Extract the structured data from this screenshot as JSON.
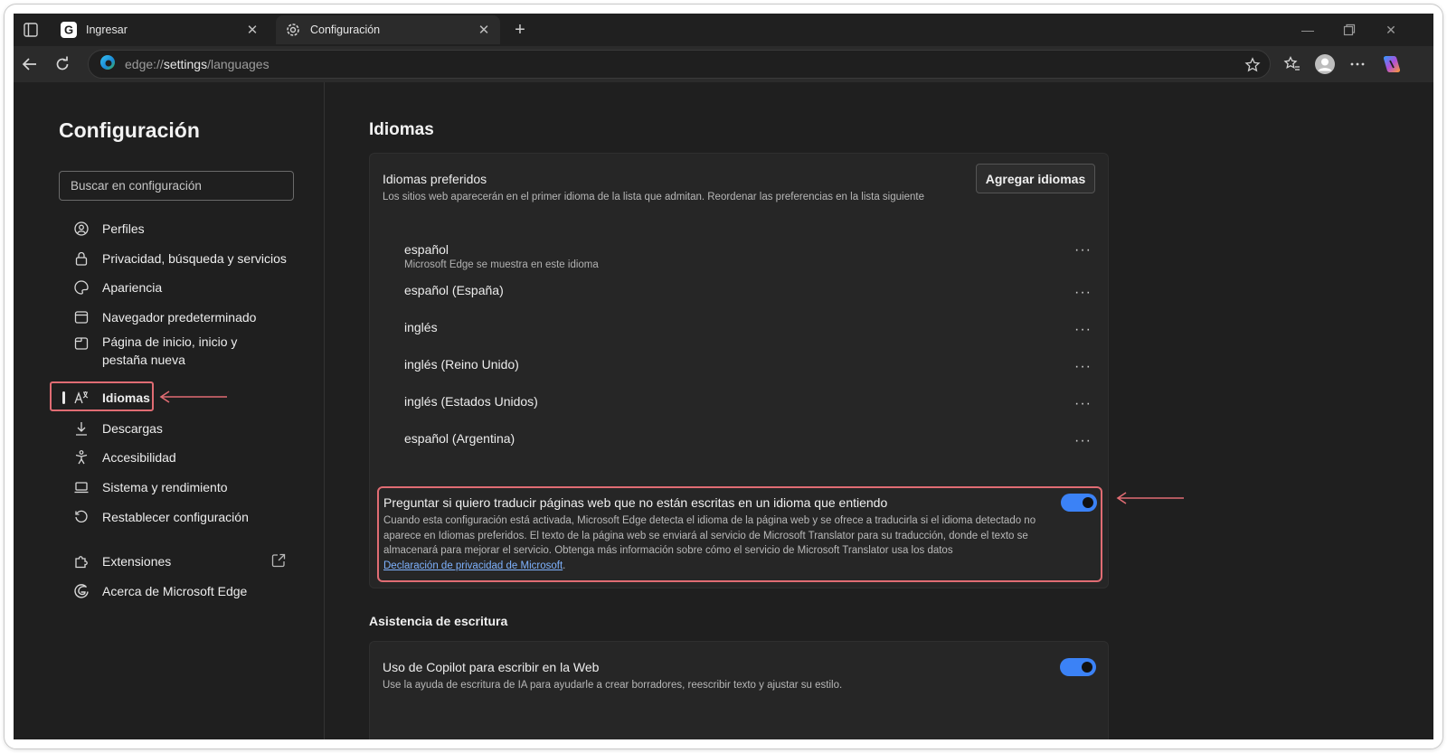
{
  "browser": {
    "tabs": [
      {
        "title": "Ingresar",
        "icon": "google-g-icon"
      },
      {
        "title": "Configuración",
        "icon": "gear-icon",
        "active": true
      }
    ],
    "address": {
      "prefix": "edge://",
      "host": "settings",
      "path": "/languages"
    }
  },
  "sidebar": {
    "title": "Configuración",
    "search_placeholder": "Buscar en configuración",
    "items": [
      {
        "label": "Perfiles",
        "icon": "profile-icon"
      },
      {
        "label": "Privacidad, búsqueda y servicios",
        "icon": "lock-icon"
      },
      {
        "label": "Apariencia",
        "icon": "palette-icon"
      },
      {
        "label": "Navegador predeterminado",
        "icon": "browser-icon"
      },
      {
        "label": "Página de inicio, inicio y pestaña nueva",
        "icon": "home-tab-icon"
      },
      {
        "label": "Idiomas",
        "icon": "language-icon",
        "active": true
      },
      {
        "label": "Descargas",
        "icon": "download-icon"
      },
      {
        "label": "Accesibilidad",
        "icon": "accessibility-icon"
      },
      {
        "label": "Sistema y rendimiento",
        "icon": "laptop-icon"
      },
      {
        "label": "Restablecer configuración",
        "icon": "reset-icon"
      },
      {
        "label": "Extensiones",
        "icon": "puzzle-icon"
      },
      {
        "label": "Acerca de Microsoft Edge",
        "icon": "edge-icon"
      }
    ]
  },
  "main": {
    "title": "Idiomas",
    "preferred": {
      "title": "Idiomas preferidos",
      "description": "Los sitios web aparecerán en el primer idioma de la lista que admitan. Reordenar las preferencias en la lista siguiente",
      "add_button": "Agregar idiomas",
      "languages": [
        {
          "name": "español",
          "sub": "Microsoft Edge se muestra en este idioma"
        },
        {
          "name": "español (España)",
          "sub": ""
        },
        {
          "name": "inglés",
          "sub": ""
        },
        {
          "name": "inglés (Reino Unido)",
          "sub": ""
        },
        {
          "name": "inglés (Estados Unidos)",
          "sub": ""
        },
        {
          "name": "español (Argentina)",
          "sub": ""
        }
      ],
      "more_label": "···"
    },
    "translate": {
      "title": "Preguntar si quiero traducir páginas web que no están escritas en un idioma que entiendo",
      "description": "Cuando esta configuración está activada, Microsoft Edge detecta el idioma de la página web y se ofrece a traducirla si el idioma detectado no aparece en Idiomas preferidos. El texto de la página web se enviará al servicio de Microsoft Translator para su traducción, donde el texto se almacenará para mejorar el servicio. Obtenga más información sobre cómo el servicio de Microsoft Translator usa los datos",
      "link": "Declaración de privacidad de Microsoft",
      "link_suffix": ".",
      "enabled": true
    },
    "writing": {
      "heading": "Asistencia de escritura",
      "copilot_title": "Uso de Copilot para escribir en la Web",
      "copilot_desc": "Use la ayuda de escritura de IA para ayudarle a crear borradores, reescribir texto y ajustar su estilo.",
      "enabled": true
    }
  },
  "colors": {
    "accent": "#3b82f6",
    "highlight": "#e06c73",
    "background": "#1f1f1f"
  }
}
